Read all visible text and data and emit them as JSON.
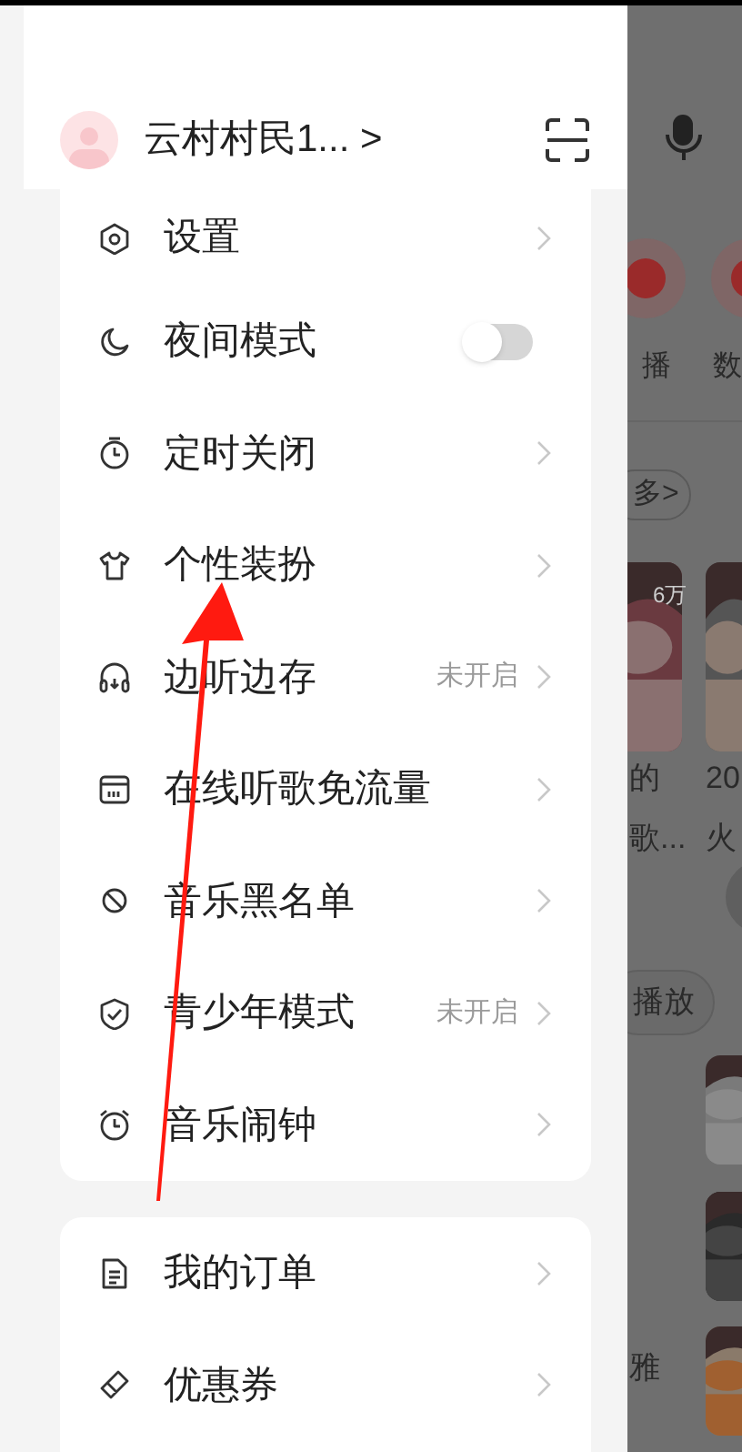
{
  "profile": {
    "name": "云村村民1...",
    "chevron": ">"
  },
  "menu_group_1": [
    {
      "label": "设置",
      "kind": "link"
    },
    {
      "label": "夜间模式",
      "kind": "toggle",
      "on": false
    },
    {
      "label": "定时关闭",
      "kind": "link"
    },
    {
      "label": "个性装扮",
      "kind": "link"
    },
    {
      "label": "边听边存",
      "kind": "link",
      "status": "未开启"
    },
    {
      "label": "在线听歌免流量",
      "kind": "link"
    },
    {
      "label": "音乐黑名单",
      "kind": "link"
    },
    {
      "label": "青少年模式",
      "kind": "link",
      "status": "未开启"
    },
    {
      "label": "音乐闹钟",
      "kind": "link"
    }
  ],
  "menu_group_2": [
    {
      "label": "我的订单",
      "kind": "link"
    },
    {
      "label": "优惠券",
      "kind": "link"
    }
  ],
  "background_app": {
    "shortcut_labels": [
      "播",
      "数"
    ],
    "more_button": "多>",
    "play_count": "6万",
    "playlist_1_title": [
      "的",
      "歌..."
    ],
    "playlist_2_title": [
      "20",
      "火"
    ],
    "play_button": "播放",
    "song_fragment": "雅"
  }
}
